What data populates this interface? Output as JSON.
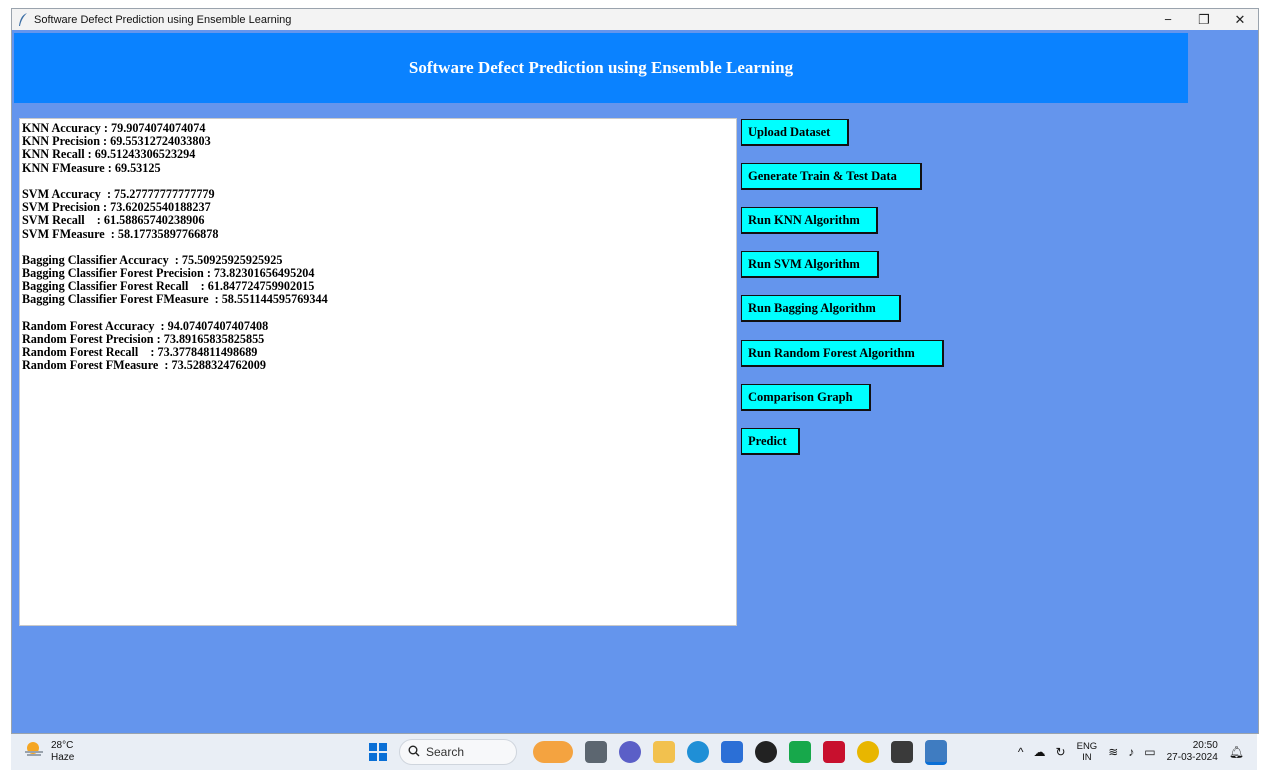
{
  "window": {
    "title": "Software Defect Prediction using Ensemble Learning",
    "controls": {
      "minimize": "−",
      "maximize": "❐",
      "close": "✕"
    }
  },
  "banner": {
    "heading": "Software Defect Prediction using Ensemble Learning"
  },
  "output_lines": [
    "KNN Accuracy : 79.9074074074074",
    "KNN Precision : 69.55312724033803",
    "KNN Recall : 69.51243306523294",
    "KNN FMeasure : 69.53125",
    "",
    "SVM Accuracy  : 75.27777777777779",
    "SVM Precision : 73.62025540188237",
    "SVM Recall    : 61.58865740238906",
    "SVM FMeasure  : 58.17735897766878",
    "",
    "Bagging Classifier Accuracy  : 75.50925925925925",
    "Bagging Classifier Forest Precision : 73.82301656495204",
    "Bagging Classifier Forest Recall    : 61.847724759902015",
    "Bagging Classifier Forest FMeasure  : 58.551144595769344",
    "",
    "Random Forest Accuracy  : 94.07407407407408",
    "Random Forest Precision : 73.89165835825855",
    "Random Forest Recall    : 73.37784811498689",
    "Random Forest FMeasure  : 73.5288324762009"
  ],
  "buttons": {
    "upload": "Upload Dataset",
    "generate": "Generate Train & Test Data",
    "knn": "Run KNN Algorithm",
    "svm": "Run SVM Algorithm",
    "bagging": "Run Bagging Algorithm",
    "random_forest": "Run Random Forest Algorithm",
    "comparison": "Comparison Graph",
    "predict": "Predict"
  },
  "taskbar": {
    "weather_temp": "28°C",
    "weather_desc": "Haze",
    "search_placeholder": "Search",
    "lang_top": "ENG",
    "lang_bottom": "IN",
    "time": "20:50",
    "date": "27-03-2024"
  },
  "colors": {
    "window_bg": "#6495ed",
    "banner_bg": "#0a82ff",
    "button_bg": "#00ffff"
  }
}
